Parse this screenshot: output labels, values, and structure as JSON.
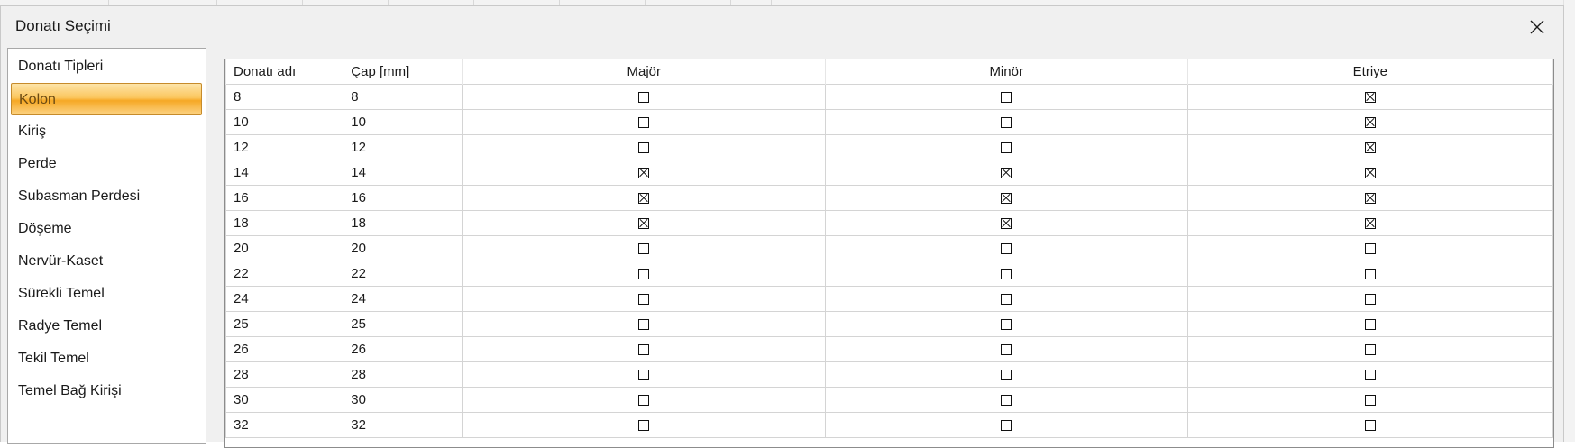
{
  "window": {
    "title": "Donatı Seçimi"
  },
  "sidebar": {
    "items": [
      {
        "label": "Donatı Tipleri",
        "selected": false
      },
      {
        "label": "Kolon",
        "selected": true
      },
      {
        "label": "Kiriş",
        "selected": false
      },
      {
        "label": "Perde",
        "selected": false
      },
      {
        "label": "Subasman Perdesi",
        "selected": false
      },
      {
        "label": "Döşeme",
        "selected": false
      },
      {
        "label": "Nervür-Kaset",
        "selected": false
      },
      {
        "label": "Sürekli Temel",
        "selected": false
      },
      {
        "label": "Radye Temel",
        "selected": false
      },
      {
        "label": "Tekil Temel",
        "selected": false
      },
      {
        "label": "Temel Bağ Kirişi",
        "selected": false
      }
    ],
    "selected_color": "#f6a825"
  },
  "table": {
    "columns": [
      "Donatı adı",
      "Çap [mm]",
      "Majör",
      "Minör",
      "Etriye"
    ],
    "rows": [
      {
        "name": "8",
        "diameter": "8",
        "major": false,
        "minor": false,
        "stirrup": true
      },
      {
        "name": "10",
        "diameter": "10",
        "major": false,
        "minor": false,
        "stirrup": true
      },
      {
        "name": "12",
        "diameter": "12",
        "major": false,
        "minor": false,
        "stirrup": true
      },
      {
        "name": "14",
        "diameter": "14",
        "major": true,
        "minor": true,
        "stirrup": true
      },
      {
        "name": "16",
        "diameter": "16",
        "major": true,
        "minor": true,
        "stirrup": true
      },
      {
        "name": "18",
        "diameter": "18",
        "major": true,
        "minor": true,
        "stirrup": true
      },
      {
        "name": "20",
        "diameter": "20",
        "major": false,
        "minor": false,
        "stirrup": false
      },
      {
        "name": "22",
        "diameter": "22",
        "major": false,
        "minor": false,
        "stirrup": false
      },
      {
        "name": "24",
        "diameter": "24",
        "major": false,
        "minor": false,
        "stirrup": false
      },
      {
        "name": "25",
        "diameter": "25",
        "major": false,
        "minor": false,
        "stirrup": false
      },
      {
        "name": "26",
        "diameter": "26",
        "major": false,
        "minor": false,
        "stirrup": false
      },
      {
        "name": "28",
        "diameter": "28",
        "major": false,
        "minor": false,
        "stirrup": false
      },
      {
        "name": "30",
        "diameter": "30",
        "major": false,
        "minor": false,
        "stirrup": false
      },
      {
        "name": "32",
        "diameter": "32",
        "major": false,
        "minor": false,
        "stirrup": false
      }
    ]
  },
  "icons": {
    "close": "close-icon"
  }
}
